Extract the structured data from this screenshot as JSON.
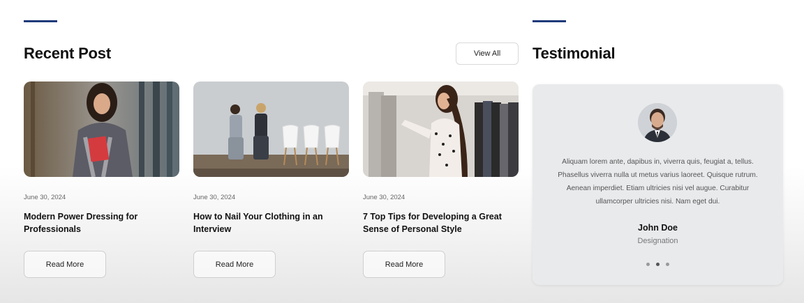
{
  "recent": {
    "title": "Recent Post",
    "view_all_label": "View All",
    "posts": [
      {
        "date": "June 30, 2024",
        "title": "Modern Power Dressing for Professionals",
        "button": "Read More"
      },
      {
        "date": "June 30, 2024",
        "title": "How to Nail Your Clothing in an Interview",
        "button": "Read More"
      },
      {
        "date": "June 30, 2024",
        "title": "7 Top Tips for Developing a Great Sense of Personal Style",
        "button": "Read More"
      }
    ]
  },
  "testimonial": {
    "title": "Testimonial",
    "quote": "Aliquam lorem ante, dapibus in, viverra quis, feugiat a, tellus. Phasellus viverra nulla ut metus varius laoreet. Quisque rutrum. Aenean imperdiet. Etiam ultricies nisi vel augue. Curabitur ullamcorper ultricies nisi. Nam eget dui.",
    "name": "John Doe",
    "role": "Designation",
    "dots_active": 1
  },
  "colors": {
    "accent": "#1f3a7a"
  }
}
